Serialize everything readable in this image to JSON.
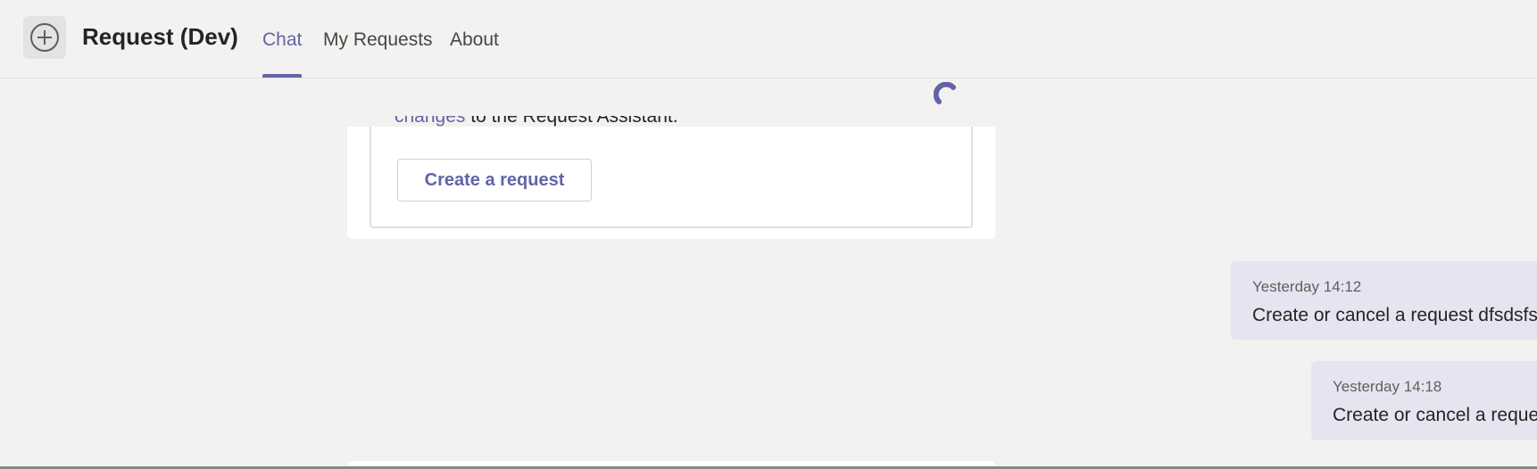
{
  "header": {
    "app_icon": "add-circle-icon",
    "title": "Request (Dev)",
    "tabs": [
      {
        "label": "Chat",
        "active": true
      },
      {
        "label": "My Requests",
        "active": false
      },
      {
        "label": "About",
        "active": false
      }
    ]
  },
  "loading": {
    "icon": "loading-spinner-icon"
  },
  "card": {
    "link_text": "changes",
    "text_after_link": " to the Request Assistant.",
    "button_label": "Create a request"
  },
  "messages": [
    {
      "time": "Yesterday 14:12",
      "text": "Create or cancel a request dfsdsfsdf"
    },
    {
      "time": "Yesterday 14:18",
      "text": "Create or cancel a request"
    }
  ],
  "colors": {
    "accent": "#6264a7",
    "background": "#f3f2f1",
    "message_bubble": "#e5e5f1",
    "card": "#ffffff"
  }
}
